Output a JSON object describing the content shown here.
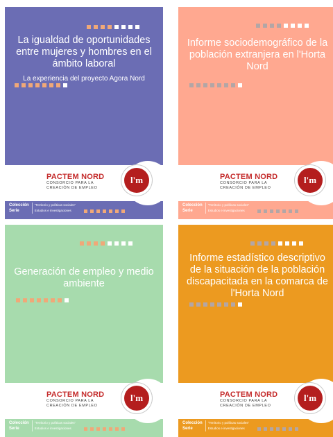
{
  "brand": {
    "name": "PACTEM NORD",
    "line1": "CONSORCIO PARA LA",
    "line2": "CREACIÓN DE EMPLEO",
    "logo_mark": "l'm"
  },
  "footer": {
    "coleccion_label": "Colección",
    "serie_label": "Serie",
    "coleccion_value": "\"Territorio y políticas sociales\"",
    "serie_value": "Estudios e investigaciones"
  },
  "covers": [
    {
      "title": "La igualdad de oportunidades entre mujeres y hombres en el ámbito laboral",
      "subtitle": "La experiencia del proyecto Agora Nord",
      "color": "#6b6db4"
    },
    {
      "title": "Informe sociodemográfico de la población extranjera en l'Horta Nord",
      "subtitle": "",
      "color": "#ffa890"
    },
    {
      "title": "Generación de empleo y medio ambiente",
      "subtitle": "",
      "color": "#a7dbad"
    },
    {
      "title": "Informe estadístico descriptivo de la situación de la población discapacitada en la comarca de l'Horta Nord",
      "subtitle": "",
      "color": "#ec9a20"
    }
  ]
}
